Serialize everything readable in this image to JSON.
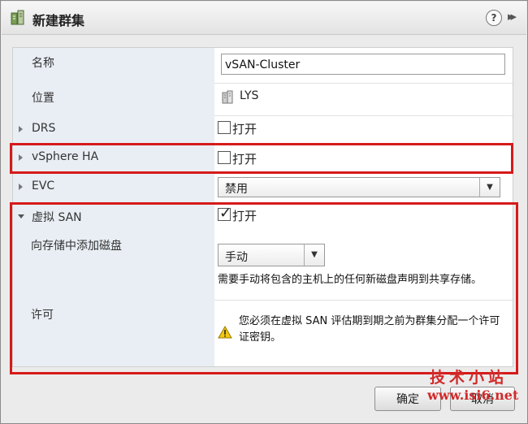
{
  "dialog": {
    "title": "新建群集",
    "help_label": "?",
    "expand_label": "▸▸"
  },
  "form": {
    "name": {
      "label": "名称",
      "value": "vSAN-Cluster"
    },
    "location": {
      "label": "位置",
      "value": "LYS"
    },
    "drs": {
      "label": "DRS",
      "checkbox_label": "打开",
      "checked": false
    },
    "ha": {
      "label": "vSphere HA",
      "checkbox_label": "打开",
      "checked": false
    },
    "evc": {
      "label": "EVC",
      "selected": "禁用"
    },
    "vsan": {
      "label": "虚拟 SAN",
      "checkbox_label": "打开",
      "checked": true
    },
    "add_disks": {
      "label": "向存储中添加磁盘",
      "selected": "手动",
      "description": "需要手动将包含的主机上的任何新磁盘声明到共享存储。"
    },
    "license": {
      "label": "许可",
      "warning": "您必须在虚拟 SAN 评估期到期之前为群集分配一个许可证密钥。"
    }
  },
  "buttons": {
    "ok": "确定",
    "cancel": "取消"
  },
  "watermark": {
    "line1": "技术小站",
    "line2": "www.isi6.net",
    "color": "#d12a2a"
  },
  "highlight_color": "#d61a1a"
}
